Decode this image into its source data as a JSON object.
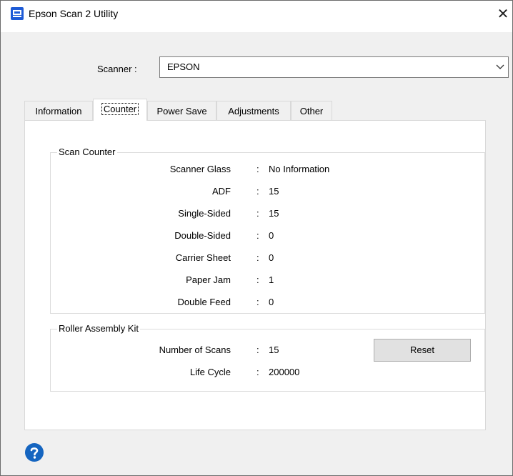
{
  "window": {
    "title": "Epson Scan 2 Utility",
    "close_glyph": "✕",
    "app_icon": "epson-scan-app-icon"
  },
  "scanner": {
    "label": "Scanner :",
    "selected": "EPSON"
  },
  "tabs": [
    {
      "label": "Information",
      "active": false
    },
    {
      "label": "Counter",
      "active": true
    },
    {
      "label": "Power Save",
      "active": false
    },
    {
      "label": "Adjustments",
      "active": false
    },
    {
      "label": "Other",
      "active": false
    }
  ],
  "scan_counter": {
    "title": "Scan Counter",
    "rows": [
      {
        "label": "Scanner Glass",
        "value": "No Information"
      },
      {
        "label": "ADF",
        "value": "15"
      },
      {
        "label": "Single-Sided",
        "value": "15"
      },
      {
        "label": "Double-Sided",
        "value": "0"
      },
      {
        "label": "Carrier Sheet",
        "value": "0"
      },
      {
        "label": "Paper Jam",
        "value": "1"
      },
      {
        "label": "Double Feed",
        "value": "0"
      }
    ]
  },
  "roller_kit": {
    "title": "Roller Assembly Kit",
    "rows": [
      {
        "label": "Number of Scans",
        "value": "15"
      },
      {
        "label": "Life Cycle",
        "value": "200000"
      }
    ],
    "reset_label": "Reset"
  },
  "footer": {
    "help_icon": "help-question-icon"
  },
  "colors": {
    "accent": "#1e5bd6",
    "help": "#1565c0",
    "panel_bg": "#ffffff",
    "window_bg": "#f0f0f0"
  }
}
